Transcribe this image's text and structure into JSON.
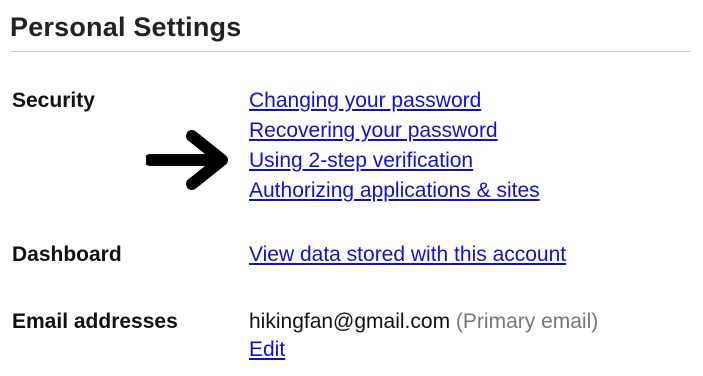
{
  "page": {
    "title": "Personal Settings"
  },
  "security": {
    "label": "Security",
    "links": [
      "Changing your password",
      "Recovering your password",
      "Using 2-step verification",
      "Authorizing applications & sites"
    ]
  },
  "dashboard": {
    "label": "Dashboard",
    "link": "View data stored with this account"
  },
  "email": {
    "label": "Email addresses",
    "address": "hikingfan@gmail.com",
    "note": "(Primary email)",
    "edit_label": "Edit"
  },
  "icons": {
    "pointer": "right-arrow-icon"
  },
  "colors": {
    "link": "#1111cc",
    "muted": "#777777",
    "rule": "#cccccc"
  }
}
